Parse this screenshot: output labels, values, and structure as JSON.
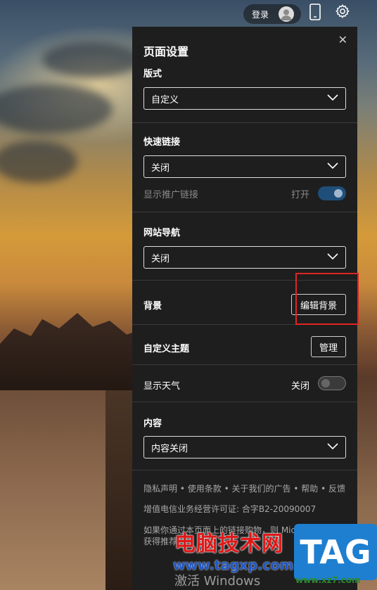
{
  "topbar": {
    "login_label": "登录"
  },
  "panel": {
    "title": "页面设置",
    "layout": {
      "label": "版式",
      "value": "自定义"
    },
    "quick_links": {
      "label": "快速链接",
      "value": "关闭",
      "promo_label": "显示推广链接",
      "promo_state": "打开"
    },
    "site_nav": {
      "label": "网站导航",
      "value": "关闭"
    },
    "background": {
      "label": "背景",
      "button": "编辑背景"
    },
    "custom_theme": {
      "label": "自定义主题",
      "button": "管理"
    },
    "weather": {
      "label": "显示天气",
      "state": "关闭"
    },
    "content": {
      "label": "内容",
      "value": "内容关闭"
    },
    "footer": {
      "links": [
        "隐私声明",
        "使用条款",
        "关于我们的广告",
        "帮助",
        "反馈"
      ],
      "separator": "•",
      "license": "增值电信业务经营许可证: 合字B2-20090007",
      "notice_line1": "如果你通过本页面上的链接购物，则 Microsoft 可能会",
      "notice_line2": "获得推荐"
    }
  },
  "watermark": {
    "site_name": "电脑技术网",
    "site_url": "www.tagxp.com",
    "windows_text": "激活 Windows",
    "logo_text": "TAG",
    "logo_url": "www.xz7.com"
  },
  "colors": {
    "panel_bg": "#1e1e1e",
    "toggle_on": "#1f4e79",
    "highlight_box": "#e02424"
  }
}
